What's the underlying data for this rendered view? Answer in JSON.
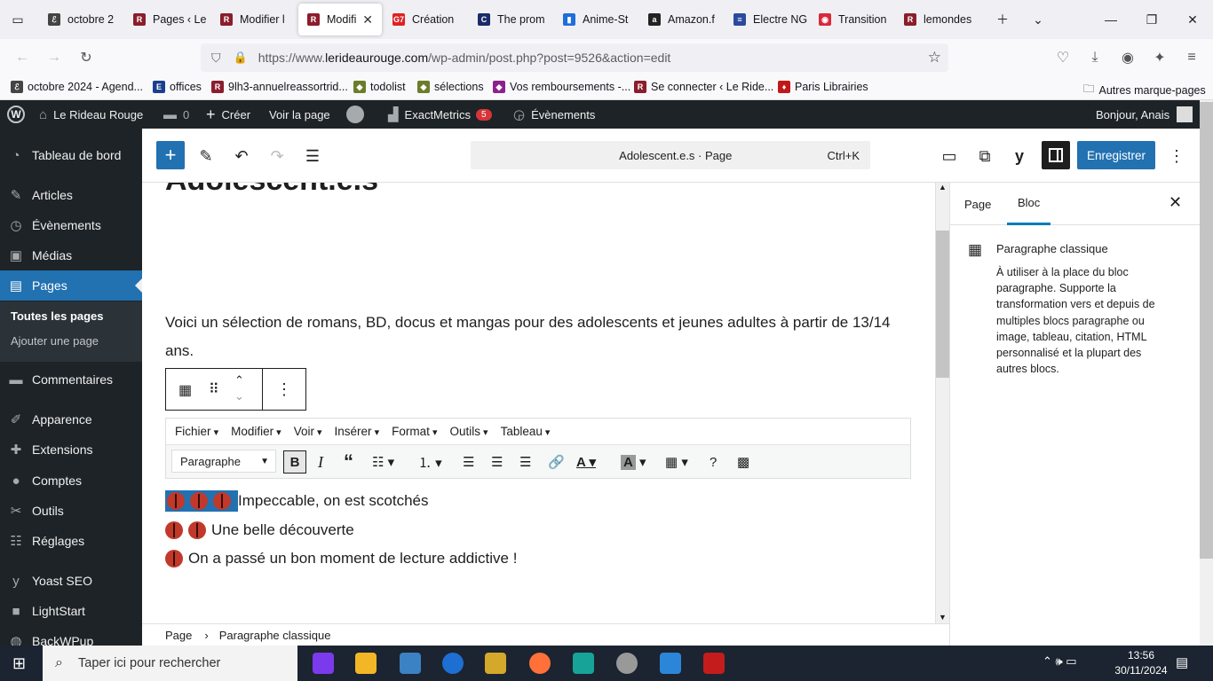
{
  "browser": {
    "tabs": [
      {
        "label": "octobre 2",
        "fav_color": "#444",
        "glyph": "ℰ"
      },
      {
        "label": "Pages ‹ Le",
        "fav_color": "#8b1d2c",
        "glyph": "R"
      },
      {
        "label": "Modifier l",
        "fav_color": "#8b1d2c",
        "glyph": "R"
      },
      {
        "label": "Modifi",
        "fav_color": "#8b1d2c",
        "glyph": "R",
        "active": true
      },
      {
        "label": "Création",
        "fav_color": "#d22",
        "glyph": "G7"
      },
      {
        "label": "The prom",
        "fav_color": "#1a2b6b",
        "glyph": "C"
      },
      {
        "label": "Anime-St",
        "fav_color": "#1e6fd9",
        "glyph": "▮"
      },
      {
        "label": "Amazon.f",
        "fav_color": "#222",
        "glyph": "a"
      },
      {
        "label": "Electre NG",
        "fav_color": "#2b4a9e",
        "glyph": "≡"
      },
      {
        "label": "Transition",
        "fav_color": "#d8293a",
        "glyph": "◉"
      },
      {
        "label": "lemondes",
        "fav_color": "#8b1d2c",
        "glyph": "R"
      }
    ],
    "url_prefix": "https://www.",
    "url_domain": "lerideaurouge.com",
    "url_path": "/wp-admin/post.php?post=9526&action=edit",
    "bookmarks": [
      {
        "label": "octobre 2024 - Agend...",
        "color": "#444",
        "glyph": "ℰ"
      },
      {
        "label": "offices",
        "color": "#1a3f8f",
        "glyph": "E"
      },
      {
        "label": "9lh3-annuelreassortrid...",
        "color": "#8b1d2c",
        "glyph": "R"
      },
      {
        "label": "todolist",
        "color": "#6b7d2a",
        "glyph": "◆"
      },
      {
        "label": "sélections",
        "color": "#6b7d2a",
        "glyph": "◆"
      },
      {
        "label": "Vos remboursements -...",
        "color": "#8e1f8e",
        "glyph": "◆"
      },
      {
        "label": "Se connecter ‹ Le Ride...",
        "color": "#8b1d2c",
        "glyph": "R"
      },
      {
        "label": "Paris Librairies",
        "color": "#c21818",
        "glyph": "♦"
      }
    ],
    "other_bookmarks": "Autres marque-pages"
  },
  "adminbar": {
    "site_name": "Le Rideau Rouge",
    "comments_count": "0",
    "new_label": "Créer",
    "view_page": "Voir la page",
    "exactmetrics": "ExactMetrics",
    "exactmetrics_badge": "5",
    "events": "Évènements",
    "greeting": "Bonjour, Anais"
  },
  "sidebar": {
    "items": [
      {
        "label": "Tableau de bord",
        "icon": "dashboard-icon",
        "glyph": "◔"
      },
      {
        "label": "Articles",
        "icon": "pin-icon",
        "glyph": "✎"
      },
      {
        "label": "Évènements",
        "icon": "calendar-icon",
        "glyph": "◷"
      },
      {
        "label": "Médias",
        "icon": "media-icon",
        "glyph": "▣"
      },
      {
        "label": "Pages",
        "icon": "pages-icon",
        "glyph": "▤",
        "current": true
      },
      {
        "label": "Commentaires",
        "icon": "comments-icon",
        "glyph": "▬"
      },
      {
        "label": "Apparence",
        "icon": "brush-icon",
        "glyph": "✐"
      },
      {
        "label": "Extensions",
        "icon": "plugin-icon",
        "glyph": "✚"
      },
      {
        "label": "Comptes",
        "icon": "user-icon",
        "glyph": "●"
      },
      {
        "label": "Outils",
        "icon": "wrench-icon",
        "glyph": "✂"
      },
      {
        "label": "Réglages",
        "icon": "settings-icon",
        "glyph": "☷"
      },
      {
        "label": "Yoast SEO",
        "icon": "yoast-icon",
        "glyph": "y"
      },
      {
        "label": "LightStart",
        "icon": "lightstart-icon",
        "glyph": "■"
      },
      {
        "label": "BackWPup",
        "icon": "backup-icon",
        "glyph": "◍"
      }
    ],
    "submenu": [
      "Toutes les pages",
      "Ajouter une page"
    ]
  },
  "editor": {
    "command_title": "Adolescent.e.s · Page",
    "command_shortcut": "Ctrl+K",
    "save_label": "Enregistrer",
    "page_title": "Adolescent.e.s",
    "intro": "Voici un sélection de romans, BD, docus et mangas pour des adolescents et jeunes adultes à partir de 13/14 ans.",
    "mce_menus": [
      "Fichier",
      "Modifier",
      "Voir",
      "Insérer",
      "Format",
      "Outils",
      "Tableau"
    ],
    "mce_format": "Paragraphe",
    "lines": [
      {
        "bugs": 3,
        "text": "Impeccable, on est scotchés"
      },
      {
        "bugs": 2,
        "text": "Une belle découverte"
      },
      {
        "bugs": 1,
        "text": "On a passé un bon moment de lecture addictive !"
      }
    ]
  },
  "panel": {
    "tab_page": "Page",
    "tab_block": "Bloc",
    "block_name": "Paragraphe classique",
    "block_desc": "À utiliser à la place du bloc paragraphe. Supporte la transformation vers et depuis de multiples blocs paragraphe ou image, tableau, citation, HTML personnalisé et la plupart des autres blocs."
  },
  "breadcrumb": {
    "root": "Page",
    "current": "Paragraphe classique"
  },
  "taskbar": {
    "search_placeholder": "Taper ici pour rechercher",
    "time": "13:56",
    "date": "30/11/2024"
  }
}
